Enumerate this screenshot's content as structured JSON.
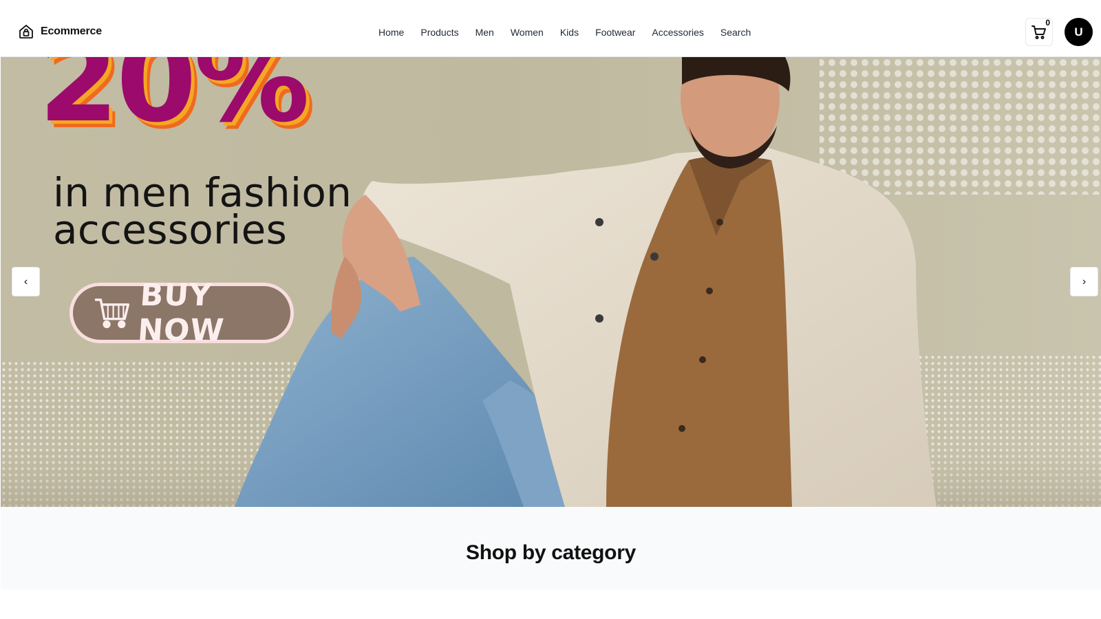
{
  "header": {
    "brand": "Ecommerce",
    "nav": [
      {
        "label": "Home"
      },
      {
        "label": "Products"
      },
      {
        "label": "Men"
      },
      {
        "label": "Women"
      },
      {
        "label": "Kids"
      },
      {
        "label": "Footwear"
      },
      {
        "label": "Accessories"
      },
      {
        "label": "Search"
      }
    ],
    "cart_count": "0",
    "avatar_initial": "U",
    "icons": {
      "logo": "home-bag-icon",
      "cart": "shopping-cart-icon"
    }
  },
  "hero": {
    "promo_percent": "20%",
    "promo_line_1": "in men fashion",
    "promo_line_2": "accessories",
    "cta_label": "BUY NOW",
    "prev_icon": "‹",
    "next_icon": "›",
    "colors": {
      "percent": "#9c0a6b",
      "percent_shadow": "#ef6a1f",
      "cta_bg": "#8b7668",
      "backdrop": "#c2bca4"
    }
  },
  "category_section": {
    "title": "Shop by category"
  }
}
